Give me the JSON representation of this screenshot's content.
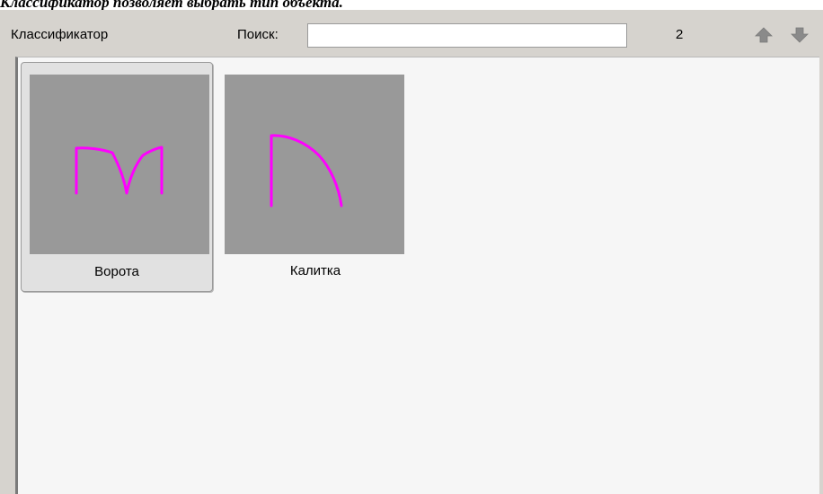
{
  "caption": "Классификатор позволяет выбрать тип объекта.",
  "toolbar": {
    "title": "Классификатор",
    "search_label": "Поиск:",
    "search_value": "",
    "count": "2",
    "up_icon": "arrow-up-icon",
    "down_icon": "arrow-down-icon"
  },
  "items": [
    {
      "label": "Ворота",
      "icon": "gate-icon",
      "selected": true
    },
    {
      "label": "Калитка",
      "icon": "wicket-icon",
      "selected": false
    }
  ],
  "colors": {
    "panel": "#d6d3ce",
    "list_background": "#f6f6f6",
    "thumb_background": "#999999",
    "stroke": "#ff00ff"
  }
}
